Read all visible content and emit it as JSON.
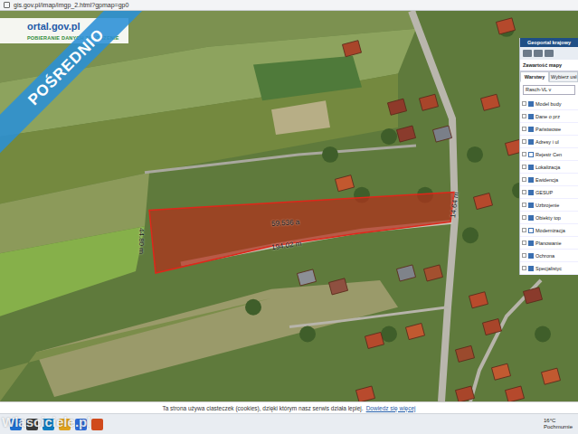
{
  "browser": {
    "address": "gis.gov.pl/imap/imgp_2.html?gpmap=gp0"
  },
  "header": {
    "logo": "ortal.gov.pl",
    "subtitle": "POBIERANIE DANYCH   ZGŁOSZENIE"
  },
  "banner": {
    "text": "POŚREDNIO"
  },
  "map": {
    "labels": [
      {
        "text": "59.536 a"
      },
      {
        "text": "194.02 m"
      },
      {
        "text": "44.80 m"
      },
      {
        "text": "14.64 m"
      }
    ]
  },
  "panel": {
    "title": "Geoportal krajowy",
    "content_title": "Zawartość mapy",
    "tabs": [
      {
        "label": "Warstwy",
        "selected": true
      },
      {
        "label": "Wybierz usł",
        "selected": false
      }
    ],
    "search": "Rasch-VL v",
    "layers": [
      {
        "label": "Model budy",
        "checked": true
      },
      {
        "label": "Dane o prz",
        "checked": true
      },
      {
        "label": "Państwowe",
        "checked": true
      },
      {
        "label": "Adresy i ul",
        "checked": true
      },
      {
        "label": "Rejestr Cen",
        "checked": false
      },
      {
        "label": "Lokalizacja",
        "checked": true
      },
      {
        "label": "Ewidencja",
        "checked": true
      },
      {
        "label": "GESUP",
        "checked": true
      },
      {
        "label": "Uzbrojenie",
        "checked": true
      },
      {
        "label": "Obiekty top",
        "checked": true
      },
      {
        "label": "Modernizacja",
        "checked": false
      },
      {
        "label": "Planowanie",
        "checked": true
      },
      {
        "label": "Ochrona",
        "checked": true
      },
      {
        "label": "Specjalistyc",
        "checked": true
      }
    ]
  },
  "cookie_bar": {
    "text": "Ta strona używa ciasteczek (cookies), dzięki którym nasz serwis działa lepiej.",
    "link": "Dowiedz się więcej"
  },
  "watermark": "Wlasciciele.pl",
  "taskbar": {
    "weather": "16°C",
    "condition": "Pochmurnie"
  }
}
